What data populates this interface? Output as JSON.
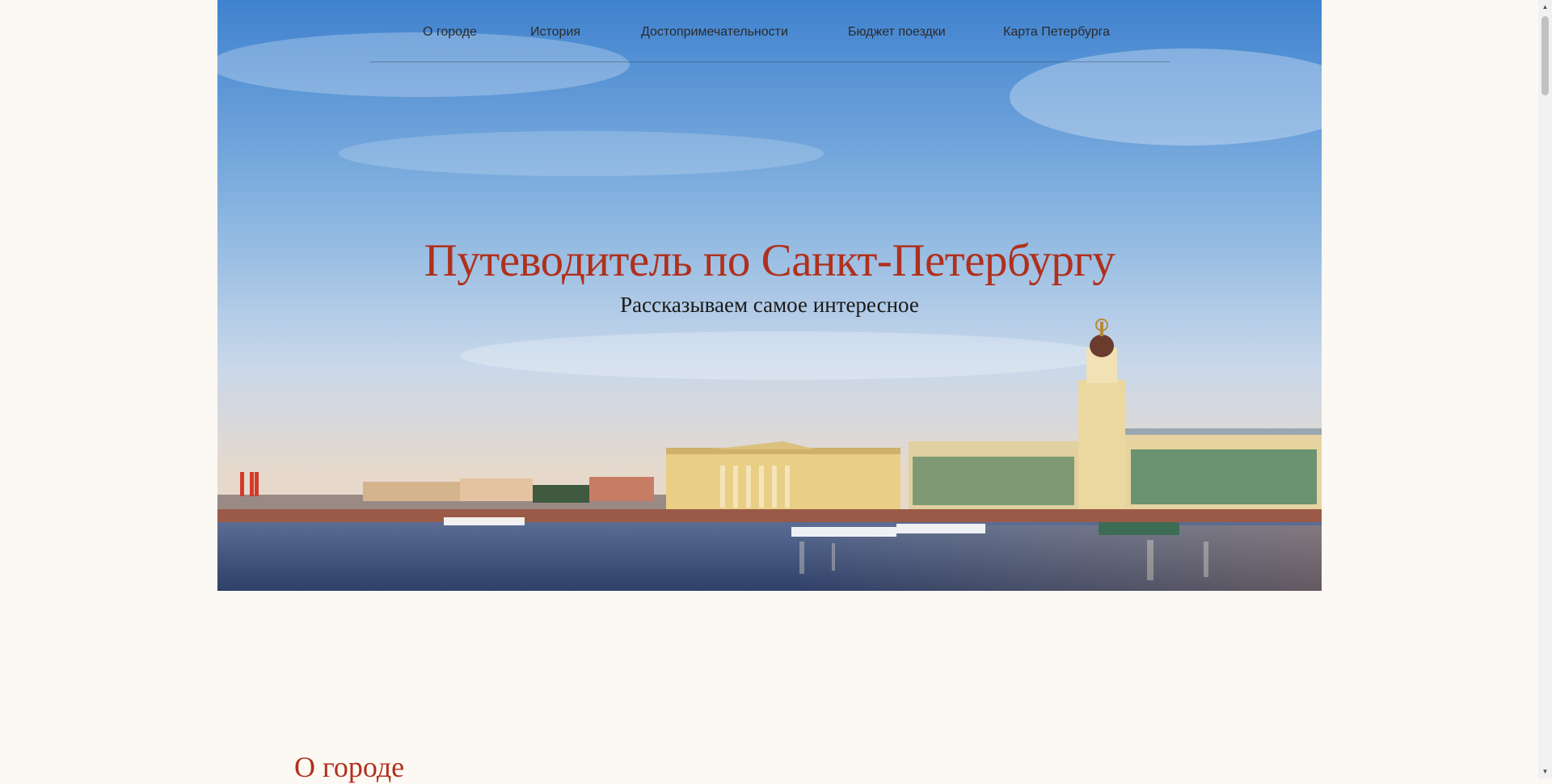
{
  "nav": {
    "items": [
      "О городе",
      "История",
      "Достопримечательности",
      "Бюджет поездки",
      "Карта Петербурга"
    ]
  },
  "hero": {
    "title": "Путеводитель по Санкт-Петербургу",
    "subtitle": "Рассказываем самое интересное",
    "image_icon": "city-embankment-photo"
  },
  "section": {
    "title": "О городе"
  },
  "colors": {
    "page_background": "#fcf8f3",
    "accent": "#b0301c",
    "nav_text": "#2a2a2a"
  },
  "scrollbar": {
    "up_icon": "scroll-up-arrow-icon",
    "down_icon": "scroll-down-arrow-icon"
  }
}
